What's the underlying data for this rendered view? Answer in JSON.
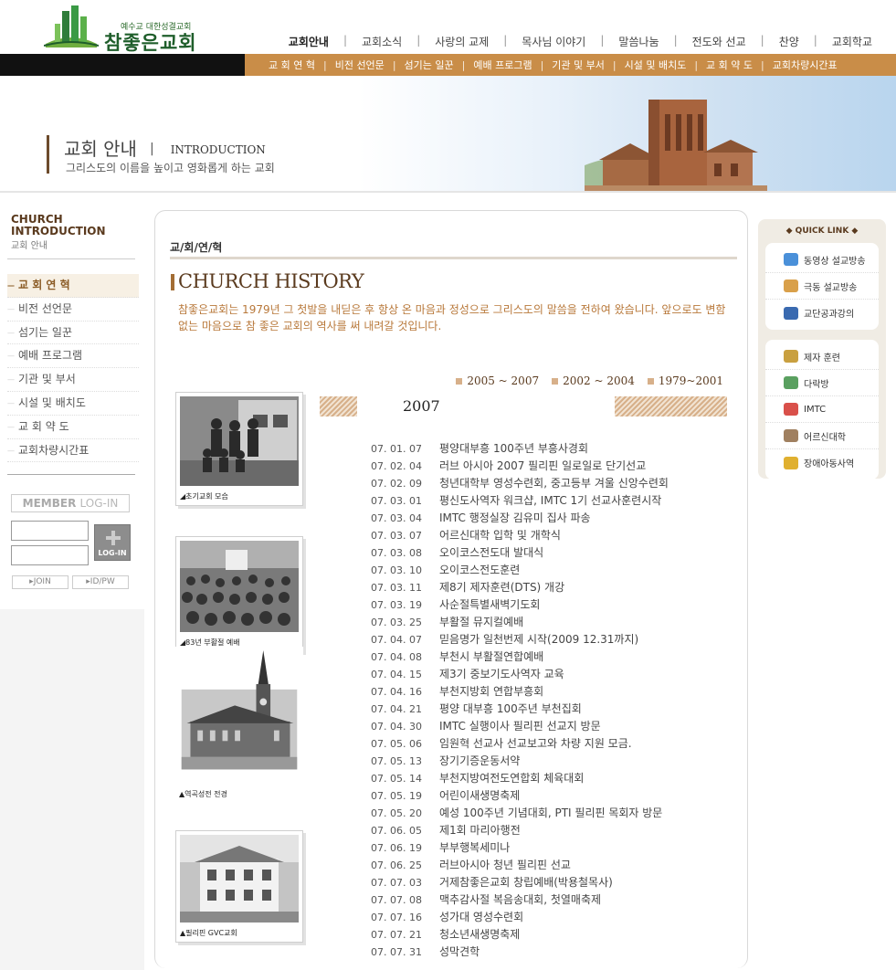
{
  "logo": {
    "subtitle": "예수교 대한성결교회",
    "name": "참좋은교회"
  },
  "topnav": {
    "items": [
      "교회안내",
      "교회소식",
      "사랑의 교제",
      "목사님 이야기",
      "말씀나눔",
      "전도와 선교",
      "찬양",
      "교회학교"
    ],
    "separator": "|"
  },
  "subnav": {
    "items": [
      "교 회 연 혁",
      "비전 선언문",
      "섬기는 일꾼",
      "예배 프로그램",
      "기관 및 부서",
      "시설 및 배치도",
      "교 회 약 도",
      "교회차량시간표"
    ],
    "separator": "|"
  },
  "banner": {
    "title": "교회 안내",
    "pipe": "|",
    "title_en": "INTRODUCTION",
    "tagline": "그리스도의 이름을 높이고 영화롭게 하는 교회"
  },
  "sidebar": {
    "head_en_1": "CHURCH",
    "head_en_2": "INTRODUCTION",
    "head_ko": "교회 안내",
    "items": [
      "교 회 연 혁",
      "비전 선언문",
      "섬기는 일꾼",
      "예배 프로그램",
      "기관 및 부서",
      "시설 및 배치도",
      "교 회 약 도",
      "교회차량시간표"
    ]
  },
  "login": {
    "title_bold": "MEMBER",
    "title_thin": "LOG-IN",
    "button": "LOG-IN",
    "join": "▸JOIN",
    "idpw": "▸ID/PW"
  },
  "main": {
    "breadcrumb": "교/회/연/혁",
    "heading": "CHURCH HISTORY",
    "intro": "참좋은교회는 1979년 그 첫발을 내딛은  후 항상 온 마음과 정성으로 그리스도의 말씀을 전하여 왔습니다. 앞으로도 변함없는 마음으로 참 좋은 교회의 역사를 써 내려갈 것입니다.",
    "year_links": [
      "2005 ~ 2007",
      "2002 ~ 2004",
      "1979~2001"
    ],
    "year": "2007",
    "photos": [
      {
        "caption": "◢초기교회 모습"
      },
      {
        "caption": "◢83년 부활절 예배"
      },
      {
        "caption": "▲역곡성전 전경"
      },
      {
        "caption": "▲필리핀 GVC교회"
      }
    ],
    "events": [
      {
        "date": "07. 01. 07",
        "text": "평양대부흥 100주년 부흥사경회"
      },
      {
        "date": "07. 02. 04",
        "text": "러브 아시아 2007 필리핀 일로일로 단기선교"
      },
      {
        "date": "07. 02. 09",
        "text": "청년대학부 영성수련회, 중고등부 겨울 신앙수련회"
      },
      {
        "date": "07. 03. 01",
        "text": "평신도사역자 워크샵, IMTC 1기 선교사훈련시작"
      },
      {
        "date": "07. 03. 04",
        "text": "IMTC 행정실장 김유미 집사 파송"
      },
      {
        "date": "07. 03. 07",
        "text": "어르신대학 입학 및 개학식"
      },
      {
        "date": "07. 03. 08",
        "text": "오이코스전도대 발대식"
      },
      {
        "date": "07. 03. 10",
        "text": "오이코스전도훈련"
      },
      {
        "date": "07. 03. 11",
        "text": "제8기 제자훈련(DTS) 개강"
      },
      {
        "date": "07. 03. 19",
        "text": "사순절특별새벽기도회"
      },
      {
        "date": "07. 03. 25",
        "text": "부활절 뮤지컬예배"
      },
      {
        "date": "07. 04. 07",
        "text": "믿음명가 일천번제 시작(2009 12.31까지)"
      },
      {
        "date": "07. 04. 08",
        "text": "부천시 부활절연합예배"
      },
      {
        "date": "07. 04. 15",
        "text": "제3기 중보기도사역자 교육"
      },
      {
        "date": "07. 04. 16",
        "text": "부천지방회 연합부흥회"
      },
      {
        "date": "07. 04. 21",
        "text": "평양 대부흥 100주년 부천집회"
      },
      {
        "date": "07. 04. 30",
        "text": "IMTC 실행이사 필리핀 선교지 방문"
      },
      {
        "date": "07. 05. 06",
        "text": "임원혁 선교사 선교보고와 차량 지원 모금."
      },
      {
        "date": "07. 05. 13",
        "text": "장기기증운동서약"
      },
      {
        "date": "07. 05. 14",
        "text": "부천지방여전도연합회 체육대회"
      },
      {
        "date": "07. 05. 19",
        "text": "어린이새생명축제"
      },
      {
        "date": "07. 05. 20",
        "text": "예성 100주년 기념대회, PTI 필리핀 목회자 방문"
      },
      {
        "date": "07. 06. 05",
        "text": "제1회 마리아행전"
      },
      {
        "date": "07. 06. 19",
        "text": "부부행복세미나"
      },
      {
        "date": "07. 06. 25",
        "text": "러브아시아 청년 필리핀 선교"
      },
      {
        "date": "07. 07. 03",
        "text": "거제참좋은교회 창립예배(박용철목사)"
      },
      {
        "date": "07. 07. 08",
        "text": "맥추감사절 복음송대회, 첫열매축제"
      },
      {
        "date": "07. 07. 16",
        "text": "성가대 영성수련회"
      },
      {
        "date": "07. 07. 21",
        "text": "청소년새생명축제"
      },
      {
        "date": "07. 07. 31",
        "text": "성막견학"
      }
    ]
  },
  "quicklink": {
    "head": "◆ QUICK LINK ◆",
    "group1": [
      {
        "label": "동영상 설교방송",
        "icon": "monitor-icon",
        "color": "#4a90d9"
      },
      {
        "label": "극동 설교방송",
        "icon": "broadcast-icon",
        "color": "#d9a04a"
      },
      {
        "label": "교단공과강의",
        "icon": "book-icon",
        "color": "#3a6ab0"
      }
    ],
    "group2": [
      {
        "label": "제자 훈련",
        "icon": "pencil-icon",
        "color": "#c9a040"
      },
      {
        "label": "다락방",
        "icon": "leaf-icon",
        "color": "#5aa060"
      },
      {
        "label": "IMTC",
        "icon": "flame-icon",
        "color": "#d9504a"
      },
      {
        "label": "어르신대학",
        "icon": "crown-icon",
        "color": "#a08060"
      },
      {
        "label": "장애아동사역",
        "icon": "person-icon",
        "color": "#e0b030"
      }
    ]
  }
}
